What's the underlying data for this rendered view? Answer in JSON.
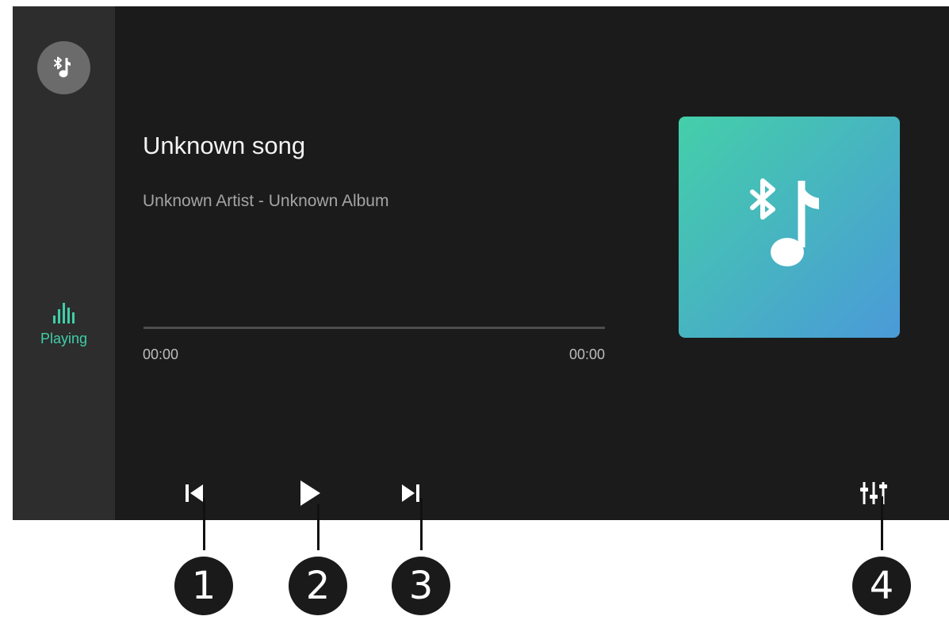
{
  "colors": {
    "background": "#1b1b1b",
    "sidebar": "#2d2d2d",
    "accent": "#3fcfa6",
    "album_gradient_start": "#44cfa9",
    "album_gradient_end": "#4a9ad8"
  },
  "sidebar": {
    "source_icon": "bluetooth-music-icon",
    "playing_icon": "equalizer-bars-icon",
    "playing_label": "Playing"
  },
  "track": {
    "title": "Unknown song",
    "subtitle": "Unknown Artist - Unknown Album",
    "elapsed": "00:00",
    "total": "00:00",
    "progress": 0
  },
  "album_art_icon": "bluetooth-music-icon",
  "controls": {
    "previous_icon": "skip-previous-icon",
    "play_icon": "play-icon",
    "next_icon": "skip-next-icon",
    "equalizer_icon": "sound-settings-icon"
  },
  "callouts": [
    "1",
    "2",
    "3",
    "4"
  ]
}
